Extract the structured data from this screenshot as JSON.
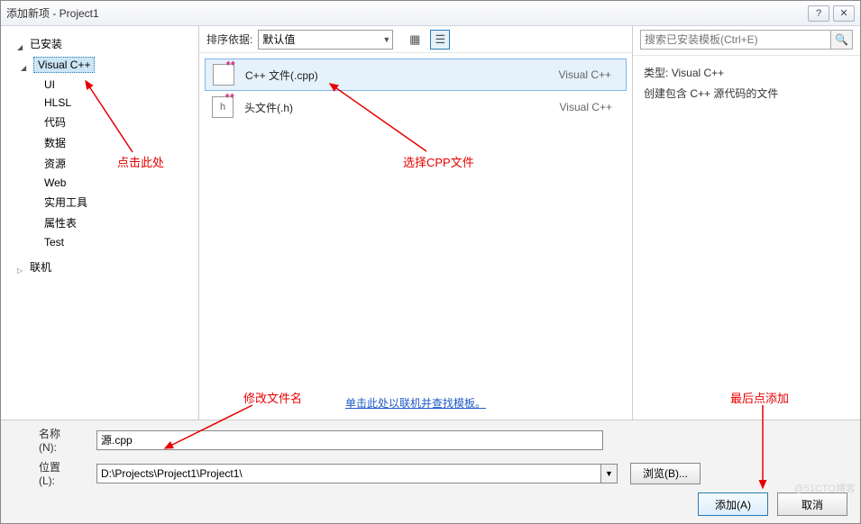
{
  "title": "添加新项 - Project1",
  "tree": {
    "installed": "已安装",
    "visual_cpp": "Visual C++",
    "items": [
      "UI",
      "HLSL",
      "代码",
      "数据",
      "资源",
      "Web",
      "实用工具",
      "属性表",
      "Test"
    ],
    "online": "联机"
  },
  "toolbar": {
    "sort_label": "排序依据:",
    "sort_value": "默认值"
  },
  "templates": [
    {
      "name": "C++ 文件(.cpp)",
      "type": "Visual C++",
      "icon": "cpp",
      "selected": true
    },
    {
      "name": "头文件(.h)",
      "type": "Visual C++",
      "icon": "h",
      "selected": false
    }
  ],
  "online_link": "单击此处以联机并查找模板。",
  "search": {
    "placeholder": "搜索已安装模板(Ctrl+E)"
  },
  "desc": {
    "type_label": "类型:",
    "type_value": "Visual C++",
    "text": "创建包含 C++ 源代码的文件"
  },
  "form": {
    "name_label": "名称(N):",
    "name_value": "源.cpp",
    "loc_label": "位置(L):",
    "loc_value": "D:\\Projects\\Project1\\Project1\\",
    "browse": "浏览(B)...",
    "add": "添加(A)",
    "cancel": "取消"
  },
  "annotations": {
    "click_here": "点击此处",
    "select_cpp": "选择CPP文件",
    "rename": "修改文件名",
    "finally_add": "最后点添加"
  },
  "watermark": "@51CTO博客"
}
